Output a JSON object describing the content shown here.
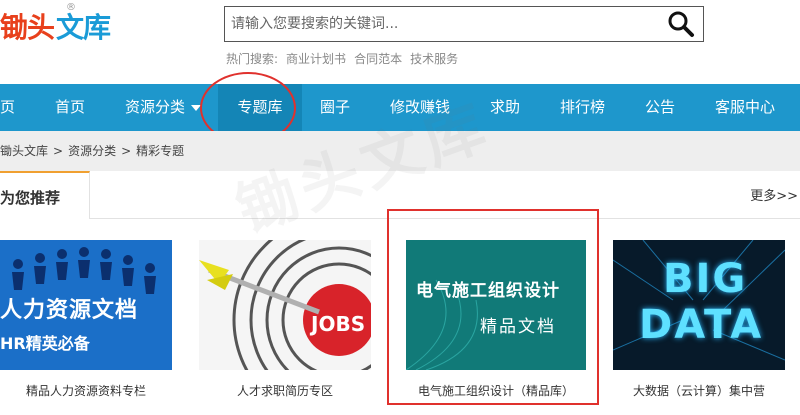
{
  "header": {
    "logo_part1": "锄头",
    "logo_part2": "文库",
    "logo_mark": "®",
    "search_placeholder": "请输入您要搜索的关键词...",
    "hot_label": "热门搜索:",
    "hot_links": [
      "商业计划书",
      "合同范本",
      "技术服务"
    ]
  },
  "nav": {
    "items": [
      {
        "label": "页"
      },
      {
        "label": "首页"
      },
      {
        "label": "资源分类"
      },
      {
        "label": "专题库"
      },
      {
        "label": "圈子"
      },
      {
        "label": "修改赚钱"
      },
      {
        "label": "求助"
      },
      {
        "label": "排行榜"
      },
      {
        "label": "公告"
      },
      {
        "label": "客服中心"
      }
    ],
    "active_index": 3
  },
  "breadcrumb": {
    "items": [
      "锄头文库",
      "资源分类",
      "精彩专题"
    ],
    "separator": ">"
  },
  "section": {
    "title": "为您推荐",
    "more": "更多>>"
  },
  "cards": [
    {
      "caption": "精品人力资源资料专栏",
      "image_text_1": "人力资源文档",
      "image_text_2": "HR精英必备"
    },
    {
      "caption": "人才求职简历专区",
      "image_text_1": "JOBS"
    },
    {
      "caption": "电气施工组织设计（精品库）",
      "image_text_1": "电气施工组织设计",
      "image_text_2": "精品文档"
    },
    {
      "caption": "大数据（云计算）集中营",
      "image_text_1": "BIG",
      "image_text_2": "DATA"
    }
  ],
  "colors": {
    "nav_bg": "#1e97cc",
    "logo_red": "#e8401c",
    "logo_blue": "#1a9bd7",
    "highlight_red": "#e0312d",
    "section_accent": "#f0a030"
  }
}
